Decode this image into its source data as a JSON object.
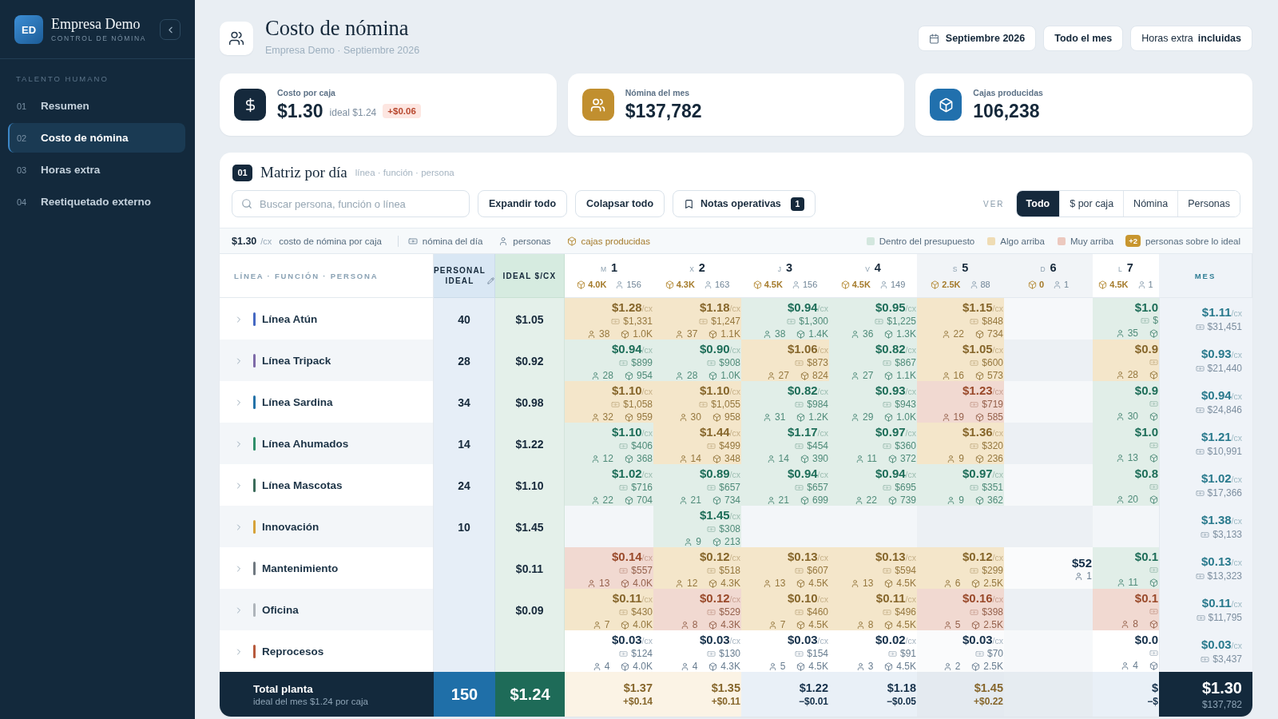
{
  "sidebar": {
    "logo": "ED",
    "company": "Empresa Demo",
    "subtitle": "CONTROL DE NÓMINA",
    "section": "TALENTO HUMANO",
    "items": [
      {
        "number": "01",
        "label": "Resumen",
        "selected": false
      },
      {
        "number": "02",
        "label": "Costo de nómina",
        "selected": true
      },
      {
        "number": "03",
        "label": "Horas extra",
        "selected": false
      },
      {
        "number": "04",
        "label": "Reetiquetado externo",
        "selected": false
      }
    ]
  },
  "header": {
    "title": "Costo de nómina",
    "subtitle": "Empresa Demo · Septiembre 2026",
    "period": "Septiembre 2026",
    "range": "Todo el mes",
    "overtime_label": "Horas extra",
    "overtime_value": "incluidas"
  },
  "kpis": [
    {
      "kind": "cost",
      "label": "Costo por caja",
      "value": "$1.30",
      "ideal": "ideal $1.24",
      "delta": "+$0.06"
    },
    {
      "kind": "payroll",
      "label": "Nómina del mes",
      "value": "$137,782"
    },
    {
      "kind": "boxes",
      "label": "Cajas producidas",
      "value": "106,238"
    }
  ],
  "matrix": {
    "number": "01",
    "title": "Matriz por día",
    "subtitle": "línea · función · persona",
    "search": {
      "placeholder": "Buscar persona, función o línea"
    },
    "buttons": [
      {
        "kind": "expand",
        "label": "Expandir todo"
      },
      {
        "kind": "collapse",
        "label": "Colapsar todo"
      },
      {
        "kind": "notes",
        "label": "Notas operativas",
        "count": "1"
      }
    ],
    "view_label": "VER",
    "views": [
      {
        "label": "Todo",
        "selected": true
      },
      {
        "label": "$ por caja",
        "selected": false
      },
      {
        "label": "Nómina",
        "selected": false
      },
      {
        "label": "Personas",
        "selected": false
      }
    ]
  },
  "legend": {
    "value": "$1.30",
    "unit": "/cx",
    "value_label": "costo de nómina por caja",
    "payroll": "nómina del día",
    "people": "personas",
    "boxes": "cajas producidas",
    "statuses": [
      {
        "kind": "within",
        "label": "Dentro del presupuesto"
      },
      {
        "kind": "over",
        "label": "Algo arriba"
      },
      {
        "kind": "high",
        "label": "Muy arriba"
      }
    ],
    "badge": "+2",
    "badge_label": "personas sobre lo ideal"
  },
  "table": {
    "columns": {
      "name": "LÍNEA · FUNCIÓN · PERSONA",
      "personal": "PERSONAL IDEAL",
      "ideal": "IDEAL $/CX",
      "month": "MES"
    },
    "days": [
      {
        "kind": "weekday",
        "weekday": "M",
        "day": "1",
        "boxes": "4.0K",
        "people": "156"
      },
      {
        "kind": "weekday",
        "weekday": "X",
        "day": "2",
        "boxes": "4.3K",
        "people": "163"
      },
      {
        "kind": "weekday",
        "weekday": "J",
        "day": "3",
        "boxes": "4.5K",
        "people": "156"
      },
      {
        "kind": "weekday",
        "weekday": "V",
        "day": "4",
        "boxes": "4.5K",
        "people": "149"
      },
      {
        "kind": "weekend",
        "weekday": "S",
        "day": "5",
        "boxes": "2.5K",
        "people": "88"
      },
      {
        "kind": "weekend",
        "weekday": "D",
        "day": "6",
        "boxes": "0",
        "people": "1"
      },
      {
        "kind": "clipped",
        "weekday": "L",
        "day": "7",
        "boxes": "4.5K",
        "people": "1"
      }
    ],
    "rows": [
      {
        "name": "Línea Atún",
        "color": "#4568c2",
        "personal": "40",
        "ideal": "$1.05",
        "cells": [
          {
            "kind": "over",
            "cost": "$1.28",
            "unit": "/cx",
            "payroll": "$1,331",
            "people": "38",
            "boxes": "1.0K"
          },
          {
            "kind": "over",
            "cost": "$1.18",
            "unit": "/cx",
            "payroll": "$1,247",
            "people": "37",
            "boxes": "1.1K"
          },
          {
            "kind": "within",
            "cost": "$0.94",
            "unit": "/cx",
            "payroll": "$1,300",
            "people": "38",
            "boxes": "1.4K"
          },
          {
            "kind": "within",
            "cost": "$0.95",
            "unit": "/cx",
            "payroll": "$1,225",
            "people": "36",
            "boxes": "1.3K"
          },
          {
            "kind": "over",
            "cost": "$1.15",
            "unit": "/cx",
            "payroll": "$848",
            "people": "22",
            "boxes": "734"
          },
          {
            "kind": "empty"
          },
          {
            "kind": "within",
            "cost": "$1.0",
            "payroll": "$",
            "people": "35"
          }
        ],
        "month": {
          "cost": "$1.11",
          "unit": "/cx",
          "payroll": "$31,451"
        }
      },
      {
        "name": "Línea Tripack",
        "color": "#7d6aa8",
        "personal": "28",
        "ideal": "$0.92",
        "cells": [
          {
            "kind": "within",
            "cost": "$0.94",
            "unit": "/cx",
            "payroll": "$899",
            "people": "28",
            "boxes": "954"
          },
          {
            "kind": "within",
            "cost": "$0.90",
            "unit": "/cx",
            "payroll": "$908",
            "people": "28",
            "boxes": "1.0K"
          },
          {
            "kind": "over",
            "cost": "$1.06",
            "unit": "/cx",
            "payroll": "$873",
            "people": "27",
            "boxes": "824"
          },
          {
            "kind": "within",
            "cost": "$0.82",
            "unit": "/cx",
            "payroll": "$867",
            "people": "27",
            "boxes": "1.1K"
          },
          {
            "kind": "over",
            "cost": "$1.05",
            "unit": "/cx",
            "payroll": "$600",
            "people": "16",
            "boxes": "573"
          },
          {
            "kind": "empty"
          },
          {
            "kind": "over",
            "cost": "$0.9",
            "people": "28"
          }
        ],
        "month": {
          "cost": "$0.93",
          "unit": "/cx",
          "payroll": "$21,440"
        }
      },
      {
        "name": "Línea Sardina",
        "color": "#2472a8",
        "personal": "34",
        "ideal": "$0.98",
        "cells": [
          {
            "kind": "over",
            "cost": "$1.10",
            "unit": "/cx",
            "payroll": "$1,058",
            "people": "32",
            "boxes": "959"
          },
          {
            "kind": "over",
            "cost": "$1.10",
            "unit": "/cx",
            "payroll": "$1,055",
            "people": "30",
            "boxes": "958"
          },
          {
            "kind": "within",
            "cost": "$0.82",
            "unit": "/cx",
            "payroll": "$984",
            "people": "31",
            "boxes": "1.2K"
          },
          {
            "kind": "within",
            "cost": "$0.93",
            "unit": "/cx",
            "payroll": "$943",
            "people": "29",
            "boxes": "1.0K"
          },
          {
            "kind": "high",
            "cost": "$1.23",
            "unit": "/cx",
            "payroll": "$719",
            "people": "19",
            "boxes": "585"
          },
          {
            "kind": "empty"
          },
          {
            "kind": "within",
            "cost": "$0.9",
            "people": "30"
          }
        ],
        "month": {
          "cost": "$0.94",
          "unit": "/cx",
          "payroll": "$24,846"
        }
      },
      {
        "name": "Línea Ahumados",
        "color": "#2f8f6a",
        "personal": "14",
        "ideal": "$1.22",
        "cells": [
          {
            "kind": "within",
            "cost": "$1.10",
            "unit": "/cx",
            "payroll": "$406",
            "people": "12",
            "boxes": "368"
          },
          {
            "kind": "over",
            "cost": "$1.44",
            "unit": "/cx",
            "payroll": "$499",
            "people": "14",
            "boxes": "348"
          },
          {
            "kind": "within",
            "cost": "$1.17",
            "unit": "/cx",
            "payroll": "$454",
            "people": "14",
            "boxes": "390"
          },
          {
            "kind": "within",
            "cost": "$0.97",
            "unit": "/cx",
            "payroll": "$360",
            "people": "11",
            "boxes": "372"
          },
          {
            "kind": "over",
            "cost": "$1.36",
            "unit": "/cx",
            "payroll": "$320",
            "people": "9",
            "boxes": "236"
          },
          {
            "kind": "empty"
          },
          {
            "kind": "within",
            "cost": "$1.0",
            "people": "13"
          }
        ],
        "month": {
          "cost": "$1.21",
          "unit": "/cx",
          "payroll": "$10,991"
        }
      },
      {
        "name": "Línea Mascotas",
        "color": "#3b6b5a",
        "personal": "24",
        "ideal": "$1.10",
        "cells": [
          {
            "kind": "within",
            "cost": "$1.02",
            "unit": "/cx",
            "payroll": "$716",
            "people": "22",
            "boxes": "704"
          },
          {
            "kind": "within",
            "cost": "$0.89",
            "unit": "/cx",
            "payroll": "$657",
            "people": "21",
            "boxes": "734"
          },
          {
            "kind": "within",
            "cost": "$0.94",
            "unit": "/cx",
            "payroll": "$657",
            "people": "21",
            "boxes": "699"
          },
          {
            "kind": "within",
            "cost": "$0.94",
            "unit": "/cx",
            "payroll": "$695",
            "people": "22",
            "boxes": "739"
          },
          {
            "kind": "within",
            "cost": "$0.97",
            "unit": "/cx",
            "payroll": "$351",
            "people": "9",
            "boxes": "362"
          },
          {
            "kind": "empty"
          },
          {
            "kind": "within",
            "cost": "$0.8",
            "people": "20"
          }
        ],
        "month": {
          "cost": "$1.02",
          "unit": "/cx",
          "payroll": "$17,366"
        }
      },
      {
        "name": "Innovación",
        "color": "#d6a23a",
        "personal": "10",
        "ideal": "$1.45",
        "cells": [
          {
            "kind": "empty"
          },
          {
            "kind": "within",
            "cost": "$1.45",
            "unit": "/cx",
            "payroll": "$308",
            "people": "9",
            "boxes": "213"
          },
          {
            "kind": "empty"
          },
          {
            "kind": "empty"
          },
          {
            "kind": "empty"
          },
          {
            "kind": "empty"
          },
          {
            "kind": "empty"
          }
        ],
        "month": {
          "cost": "$1.38",
          "unit": "/cx",
          "payroll": "$3,133"
        }
      },
      {
        "name": "Mantenimiento",
        "color": "#6f7880",
        "ideal": "$0.11",
        "cells": [
          {
            "kind": "high",
            "cost": "$0.14",
            "unit": "/cx",
            "payroll": "$557",
            "people": "13",
            "boxes": "4.0K"
          },
          {
            "kind": "over",
            "cost": "$0.12",
            "unit": "/cx",
            "payroll": "$518",
            "people": "12",
            "boxes": "4.3K"
          },
          {
            "kind": "over",
            "cost": "$0.13",
            "unit": "/cx",
            "payroll": "$607",
            "people": "13",
            "boxes": "4.5K"
          },
          {
            "kind": "over",
            "cost": "$0.13",
            "unit": "/cx",
            "payroll": "$594",
            "people": "13",
            "boxes": "4.5K"
          },
          {
            "kind": "over",
            "cost": "$0.12",
            "unit": "/cx",
            "payroll": "$299",
            "people": "6",
            "boxes": "2.5K"
          },
          {
            "kind": "neutral",
            "cost": "$52",
            "people": "1"
          },
          {
            "kind": "within",
            "cost": "$0.1",
            "people": "11"
          }
        ],
        "month": {
          "cost": "$0.13",
          "unit": "/cx",
          "payroll": "$13,323"
        }
      },
      {
        "name": "Oficina",
        "color": "#aeb4ba",
        "ideal": "$0.09",
        "cells": [
          {
            "kind": "over",
            "cost": "$0.11",
            "unit": "/cx",
            "payroll": "$430",
            "people": "7",
            "boxes": "4.0K"
          },
          {
            "kind": "high",
            "cost": "$0.12",
            "unit": "/cx",
            "payroll": "$529",
            "people": "8",
            "boxes": "4.3K"
          },
          {
            "kind": "over",
            "cost": "$0.10",
            "unit": "/cx",
            "payroll": "$460",
            "people": "7",
            "boxes": "4.5K"
          },
          {
            "kind": "over",
            "cost": "$0.11",
            "unit": "/cx",
            "payroll": "$496",
            "people": "8",
            "boxes": "4.5K"
          },
          {
            "kind": "high",
            "cost": "$0.16",
            "unit": "/cx",
            "payroll": "$398",
            "people": "5",
            "boxes": "2.5K"
          },
          {
            "kind": "empty"
          },
          {
            "kind": "high",
            "cost": "$0.1",
            "people": "8"
          }
        ],
        "month": {
          "cost": "$0.11",
          "unit": "/cx",
          "payroll": "$11,795"
        }
      },
      {
        "name": "Reprocesos",
        "color": "#b75a3c",
        "cells": [
          {
            "kind": "neutral",
            "cost": "$0.03",
            "unit": "/cx",
            "payroll": "$124",
            "people": "4",
            "boxes": "4.0K"
          },
          {
            "kind": "neutral",
            "cost": "$0.03",
            "unit": "/cx",
            "payroll": "$130",
            "people": "4",
            "boxes": "4.3K"
          },
          {
            "kind": "neutral",
            "cost": "$0.03",
            "unit": "/cx",
            "payroll": "$154",
            "people": "5",
            "boxes": "4.5K"
          },
          {
            "kind": "neutral",
            "cost": "$0.02",
            "unit": "/cx",
            "payroll": "$91",
            "people": "3",
            "boxes": "4.5K"
          },
          {
            "kind": "neutral",
            "cost": "$0.03",
            "unit": "/cx",
            "payroll": "$70",
            "people": "2",
            "boxes": "2.5K"
          },
          {
            "kind": "empty"
          },
          {
            "kind": "neutral",
            "cost": "$0.0",
            "people": "4"
          }
        ],
        "month": {
          "cost": "$0.03",
          "unit": "/cx",
          "payroll": "$3,437"
        }
      }
    ],
    "total": {
      "label": "Total planta",
      "note": "ideal del mes $1.24 por caja",
      "personal": "150",
      "ideal": "$1.24",
      "cells": [
        {
          "kind": "over",
          "cost": "$1.37",
          "delta": "+$0.14"
        },
        {
          "kind": "over",
          "cost": "$1.35",
          "delta": "+$0.11"
        },
        {
          "kind": "under",
          "cost": "$1.22",
          "delta": "−$0.01"
        },
        {
          "kind": "under",
          "cost": "$1.18",
          "delta": "−$0.05"
        },
        {
          "kind": "over",
          "cost": "$1.45",
          "delta": "+$0.22"
        },
        {
          "kind": "empty"
        },
        {
          "kind": "under",
          "cost": "$",
          "delta": "−$"
        }
      ],
      "month": {
        "cost": "$1.30",
        "payroll": "$137,782"
      }
    }
  }
}
